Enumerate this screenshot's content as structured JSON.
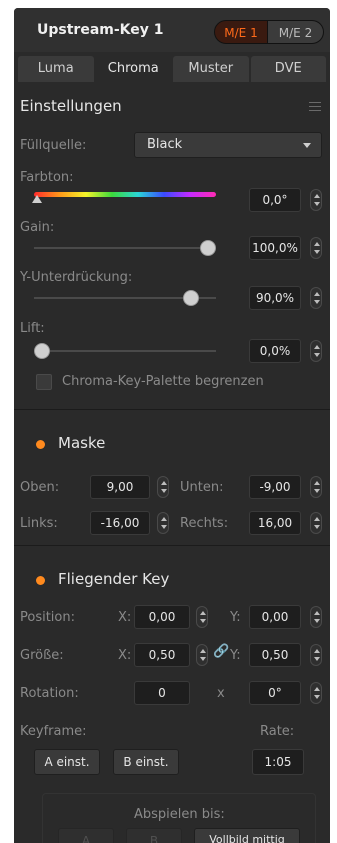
{
  "header": {
    "title": "Upstream-Key 1",
    "me1": "M/E 1",
    "me2": "M/E 2"
  },
  "tabs": [
    "Luma",
    "Chroma",
    "Muster",
    "DVE"
  ],
  "settings": {
    "heading": "Einstellungen",
    "fill_label": "Füllquelle:",
    "fill_value": "Black",
    "hue_label": "Farbton:",
    "hue_value": "0,0°",
    "gain_label": "Gain:",
    "gain_value": "100,0%",
    "gain_level": 1.0,
    "ysup_label": "Y-Unterdrückung:",
    "ysup_value": "90,0%",
    "ysup_level": 0.9,
    "lift_label": "Lift:",
    "lift_value": "0,0%",
    "lift_level": 0.0,
    "palette_label": "Chroma-Key-Palette begrenzen"
  },
  "mask": {
    "heading": "Maske",
    "top_label": "Oben:",
    "top_value": "9,00",
    "bottom_label": "Unten:",
    "bottom_value": "-9,00",
    "left_label": "Links:",
    "left_value": "-16,00",
    "right_label": "Rechts:",
    "right_value": "16,00"
  },
  "fly": {
    "heading": "Fliegender Key",
    "position_label": "Position:",
    "x_label": "X:",
    "y_label": "Y:",
    "pos_x": "0,00",
    "pos_y": "0,00",
    "size_label": "Größe:",
    "size_x": "0,50",
    "size_y": "0,50",
    "rotation_label": "Rotation:",
    "rot_turns": "0",
    "rot_x": "x",
    "rot_deg": "0°",
    "keyframe_label": "Keyframe:",
    "rate_label": "Rate:",
    "rate_value": "1:05",
    "set_a": "A einst.",
    "set_b": "B einst.",
    "play_label": "Abspielen bis:",
    "play_a": "A",
    "play_b": "B",
    "play_full": "Vollbild mittig"
  },
  "colors": {
    "accent": "#ff6a1a",
    "dot": "#ff8a1e",
    "panel": "#2a2a2a"
  }
}
